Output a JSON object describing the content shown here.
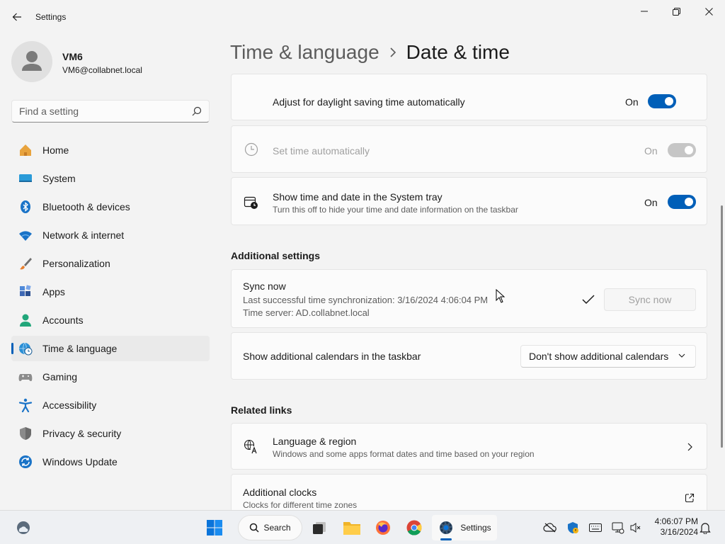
{
  "app": {
    "title": "Settings"
  },
  "user": {
    "name": "VM6",
    "email": "VM6@collabnet.local"
  },
  "search": {
    "placeholder": "Find a setting"
  },
  "nav": [
    {
      "label": "Home",
      "icon": "home-icon"
    },
    {
      "label": "System",
      "icon": "system-icon"
    },
    {
      "label": "Bluetooth & devices",
      "icon": "bluetooth-icon"
    },
    {
      "label": "Network & internet",
      "icon": "wifi-icon"
    },
    {
      "label": "Personalization",
      "icon": "brush-icon"
    },
    {
      "label": "Apps",
      "icon": "apps-icon"
    },
    {
      "label": "Accounts",
      "icon": "accounts-icon"
    },
    {
      "label": "Time & language",
      "icon": "globe-clock-icon",
      "active": true
    },
    {
      "label": "Gaming",
      "icon": "gamepad-icon"
    },
    {
      "label": "Accessibility",
      "icon": "accessibility-icon"
    },
    {
      "label": "Privacy & security",
      "icon": "shield-icon"
    },
    {
      "label": "Windows Update",
      "icon": "update-icon"
    }
  ],
  "breadcrumb": {
    "parent": "Time & language",
    "current": "Date & time"
  },
  "settings": {
    "dst": {
      "title": "Adjust for daylight saving time automatically",
      "state": "On"
    },
    "set_time_auto": {
      "title": "Set time automatically",
      "state": "On",
      "disabled": true
    },
    "tray": {
      "title": "Show time and date in the System tray",
      "desc": "Turn this off to hide your time and date information on the taskbar",
      "state": "On"
    }
  },
  "additional": {
    "heading": "Additional settings",
    "sync": {
      "title": "Sync now",
      "last_sync": "Last successful time synchronization: 3/16/2024 4:06:04 PM",
      "server": "Time server: AD.collabnet.local",
      "button": "Sync now"
    },
    "calendars": {
      "title": "Show additional calendars in the taskbar",
      "selected": "Don't show additional calendars"
    }
  },
  "related": {
    "heading": "Related links",
    "language": {
      "title": "Language & region",
      "desc": "Windows and some apps format dates and time based on your region"
    },
    "clocks": {
      "title": "Additional clocks",
      "desc": "Clocks for different time zones"
    }
  },
  "taskbar": {
    "search_label": "Search",
    "settings_label": "Settings",
    "time": "4:06:07 PM",
    "date": "3/16/2024"
  },
  "colors": {
    "accent": "#005fb8",
    "background": "#f3f3f3",
    "card": "#fbfbfb"
  }
}
